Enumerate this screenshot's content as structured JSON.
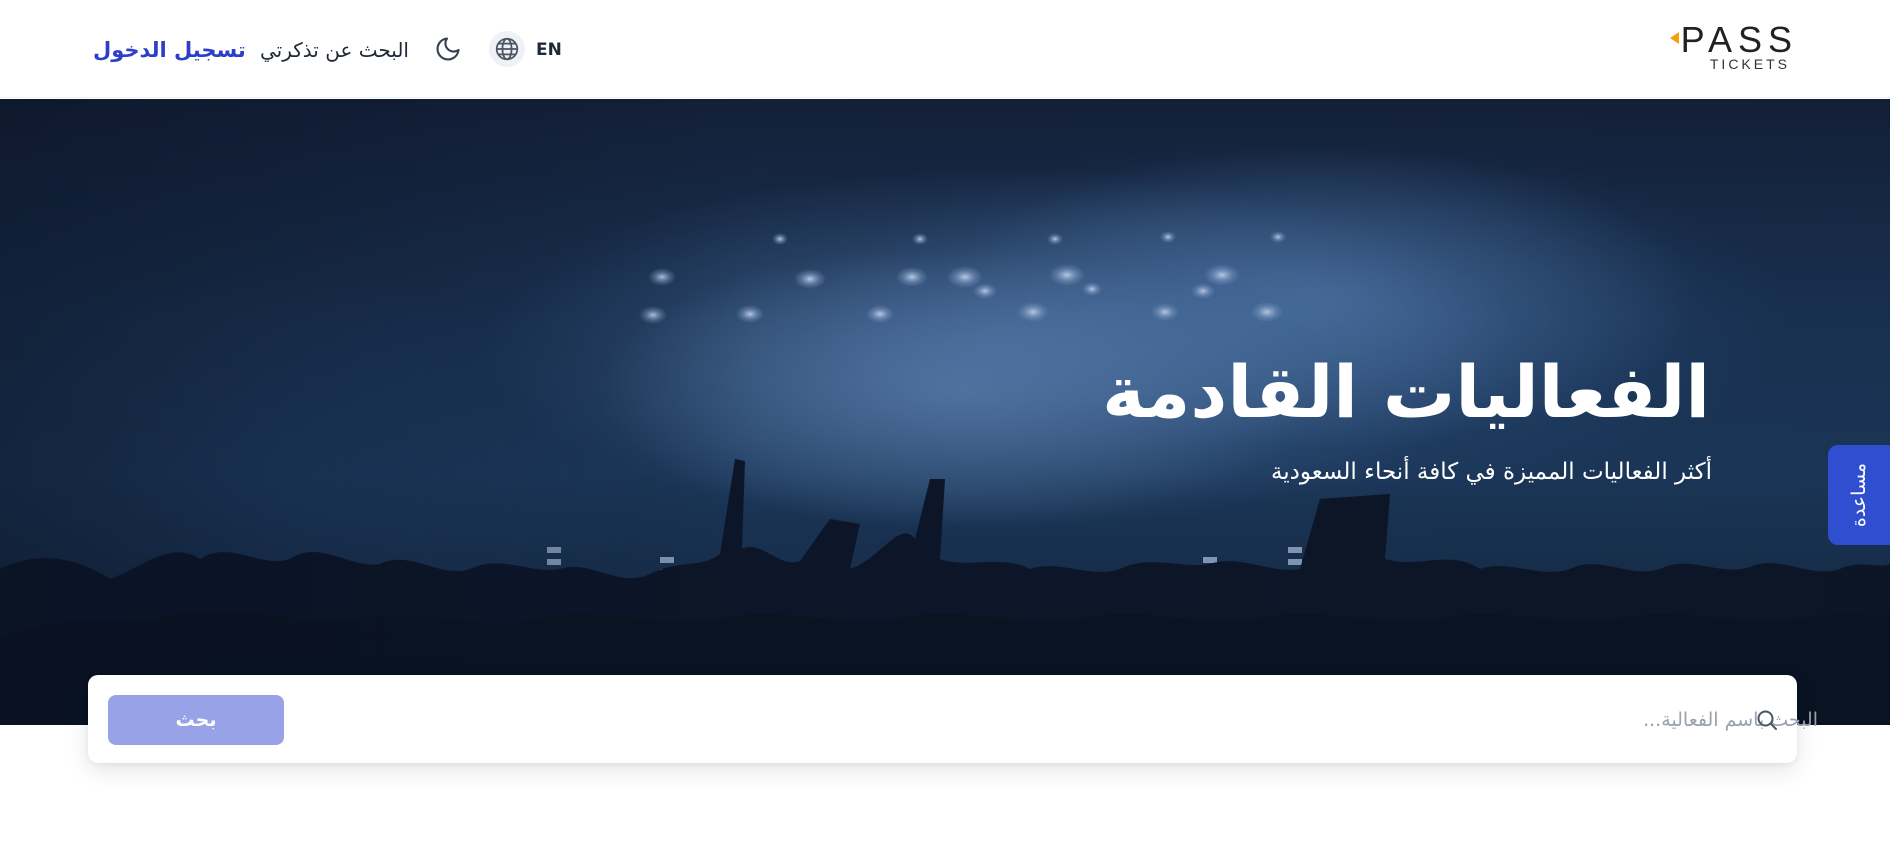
{
  "header": {
    "logo_main": "PASS",
    "logo_sub": "TICKETS",
    "login_label": "تسجيل الدخول",
    "find_ticket_label": "البحث عن تذكرتي",
    "language_label": "EN"
  },
  "hero": {
    "title": "الفعاليات القادمة",
    "subtitle": "أكثر الفعاليات المميزة في كافة أنحاء السعودية"
  },
  "help_tab": {
    "label": "مساعدة"
  },
  "search": {
    "placeholder": "البحث باسم الفعالية...",
    "value": "",
    "button_label": "بحث"
  },
  "colors": {
    "accent": "#2b3fc9",
    "search_button": "#97a3e6",
    "help_tab": "#2f4fd0",
    "logo_accent": "#f59e0b"
  },
  "icons": {
    "theme": "moon-icon",
    "language": "globe-icon",
    "search": "search-icon"
  }
}
